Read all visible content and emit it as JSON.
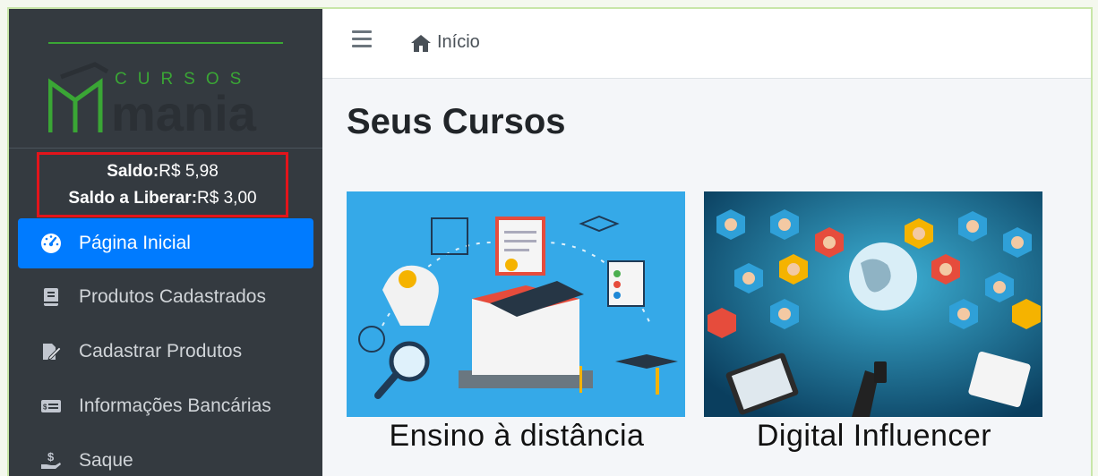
{
  "brand": {
    "top_text": "CURSOS",
    "main_text": "mania"
  },
  "balance": {
    "saldo_label": "Saldo:",
    "saldo_value": "R$ 5,98",
    "liberar_label": "Saldo a Liberar:",
    "liberar_value": "R$ 3,00"
  },
  "sidebar": {
    "items": [
      {
        "label": "Página Inicial",
        "icon": "dashboard-icon",
        "active": true
      },
      {
        "label": "Produtos Cadastrados",
        "icon": "book-icon"
      },
      {
        "label": "Cadastrar Produtos",
        "icon": "edit-icon"
      },
      {
        "label": "Informações Bancárias",
        "icon": "money-check-icon"
      },
      {
        "label": "Saque",
        "icon": "hand-dollar-icon"
      }
    ]
  },
  "topbar": {
    "breadcrumb": "Início"
  },
  "main": {
    "title": "Seus Cursos",
    "courses": [
      {
        "title": "Ensino à distância"
      },
      {
        "title": "Digital Influencer"
      }
    ]
  },
  "colors": {
    "sidebar": "#343a40",
    "active": "#007bff",
    "brand_green": "#3aa635",
    "highlight": "#e3141b"
  }
}
